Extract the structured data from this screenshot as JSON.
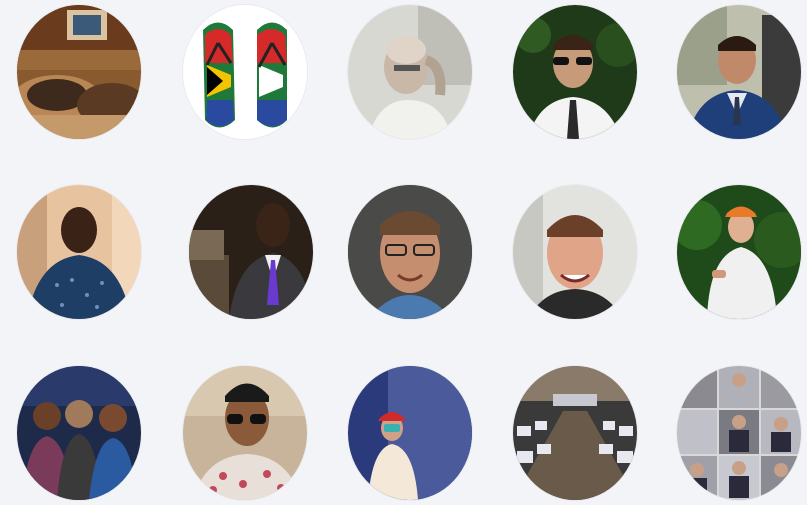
{
  "profiles": [
    {
      "icon": "profile-photo-dog-on-bed"
    },
    {
      "icon": "profile-photo-flag-flip-flops"
    },
    {
      "icon": "profile-photo-bald-man-bw"
    },
    {
      "icon": "profile-photo-man-sunglasses-tie"
    },
    {
      "icon": "profile-photo-man-in-car-suit"
    },
    {
      "icon": "profile-photo-man-blue-shirt"
    },
    {
      "icon": "profile-photo-man-suit-purple-tie"
    },
    {
      "icon": "profile-photo-man-glasses-closeup"
    },
    {
      "icon": "profile-photo-man-smiling"
    },
    {
      "icon": "profile-photo-man-orange-cap"
    },
    {
      "icon": "profile-photo-group-selfie"
    },
    {
      "icon": "profile-photo-man-sunglasses-floral"
    },
    {
      "icon": "profile-photo-person-red-cap"
    },
    {
      "icon": "profile-photo-computer-lab"
    },
    {
      "icon": "profile-photo-collage-men-suits"
    }
  ],
  "colors": {
    "background": "#f3f4f8"
  }
}
